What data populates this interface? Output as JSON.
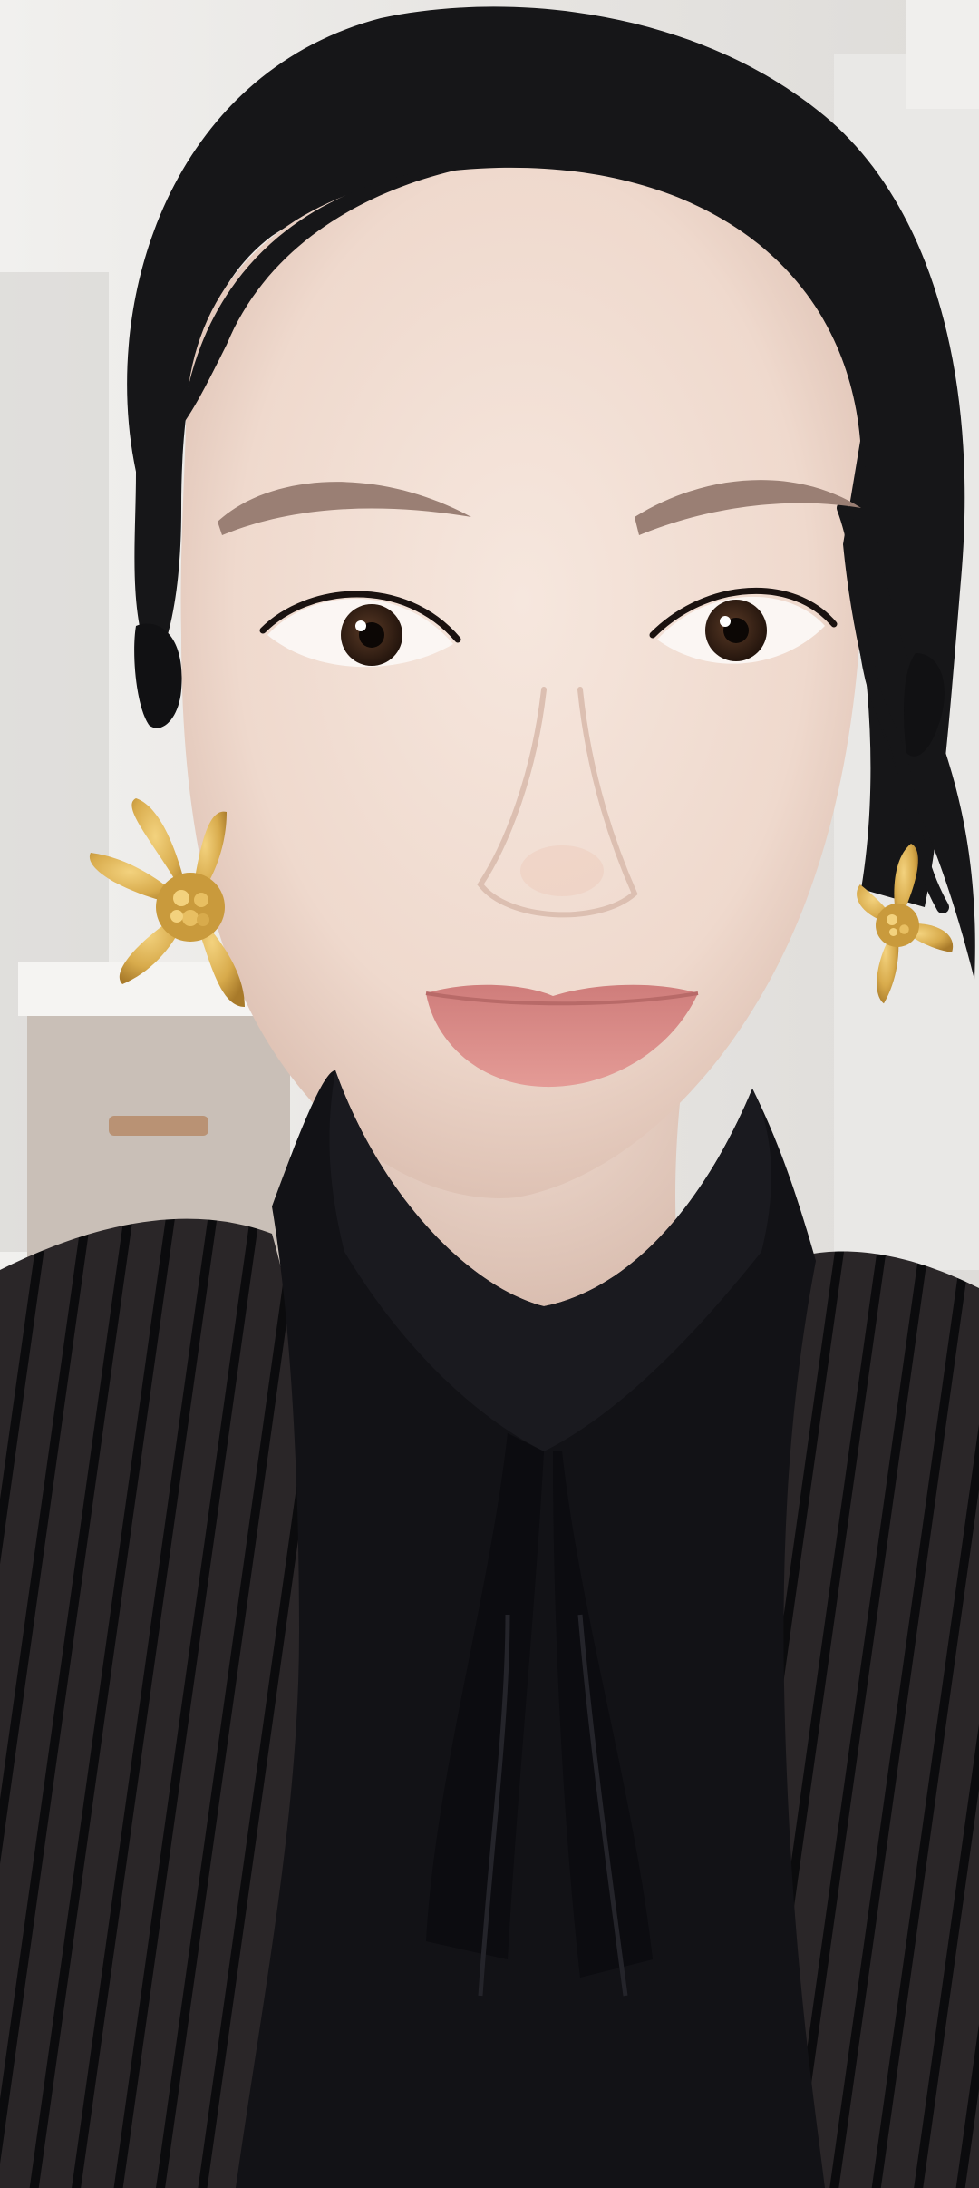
{
  "scene": {
    "kind": "selfie-video-frame",
    "subject": "woman-portrait",
    "colors": {
      "background_wall": "#eceae7",
      "background_shadow": "#cfccc8",
      "counter_top": "#f3f2f0",
      "cabinet": "#c9bfb7",
      "cabinet_handle": "#b99274",
      "skin": "#f1ddd2",
      "skin_shadow": "#dcbfb1",
      "hair": "#161618",
      "eyebrow": "#9a7f74",
      "iris": "#3b2518",
      "lips": "#d98c89",
      "earring_gold": "#d8ab4c",
      "earring_black": "#111113",
      "blouse": "#121216",
      "sheer_overlay": "#2a2628",
      "stripe": "#0b0b0d"
    },
    "elements": [
      {
        "name": "hair",
        "icon": "hair-shape"
      },
      {
        "name": "face",
        "icon": "face-shape"
      },
      {
        "name": "left-flower-earring",
        "icon": "flower-earring-icon"
      },
      {
        "name": "right-flower-earring",
        "icon": "flower-earring-icon"
      },
      {
        "name": "black-blouse",
        "icon": "blouse-shape"
      },
      {
        "name": "striped-sheer-jacket",
        "icon": "striped-jacket-shape"
      }
    ]
  }
}
